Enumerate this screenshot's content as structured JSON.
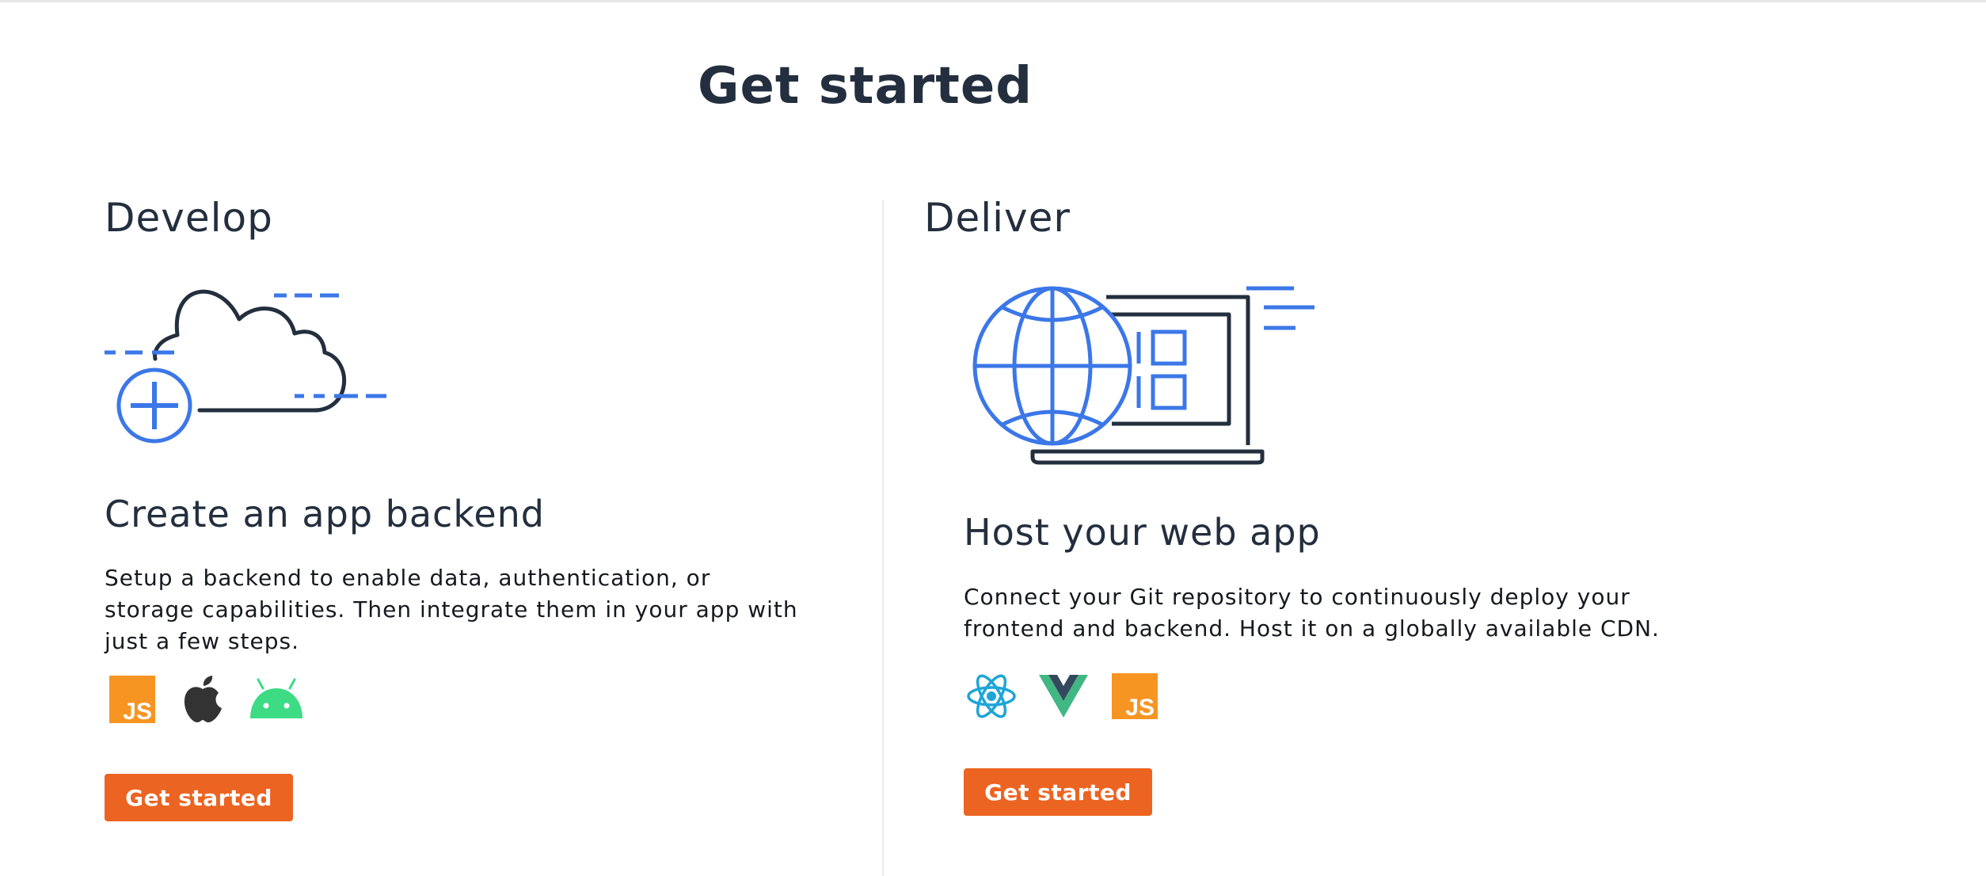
{
  "page": {
    "title": "Get started"
  },
  "develop": {
    "section_title": "Develop",
    "card_title": "Create an app backend",
    "description": "Setup a backend to enable data, authentication, or storage capabilities. Then integrate them in your app with just a few steps.",
    "platform_icons": [
      "javascript-icon",
      "apple-icon",
      "android-icon"
    ],
    "js_badge": "JS",
    "button_label": "Get started"
  },
  "deliver": {
    "section_title": "Deliver",
    "card_title": "Host your web app",
    "description": "Connect your Git repository to continuously deploy your frontend and backend. Host it on a globally available CDN.",
    "platform_icons": [
      "react-icon",
      "vue-icon",
      "javascript-icon"
    ],
    "js_badge": "JS",
    "button_label": "Get started"
  },
  "colors": {
    "accent_blue": "#3b77e8",
    "ink": "#232f3e",
    "button_orange": "#ec6421",
    "js_orange": "#f79523",
    "android_green": "#3ddc84",
    "react_cyan": "#1ea5d8",
    "vue_green": "#41b883",
    "vue_dark": "#35495e"
  }
}
